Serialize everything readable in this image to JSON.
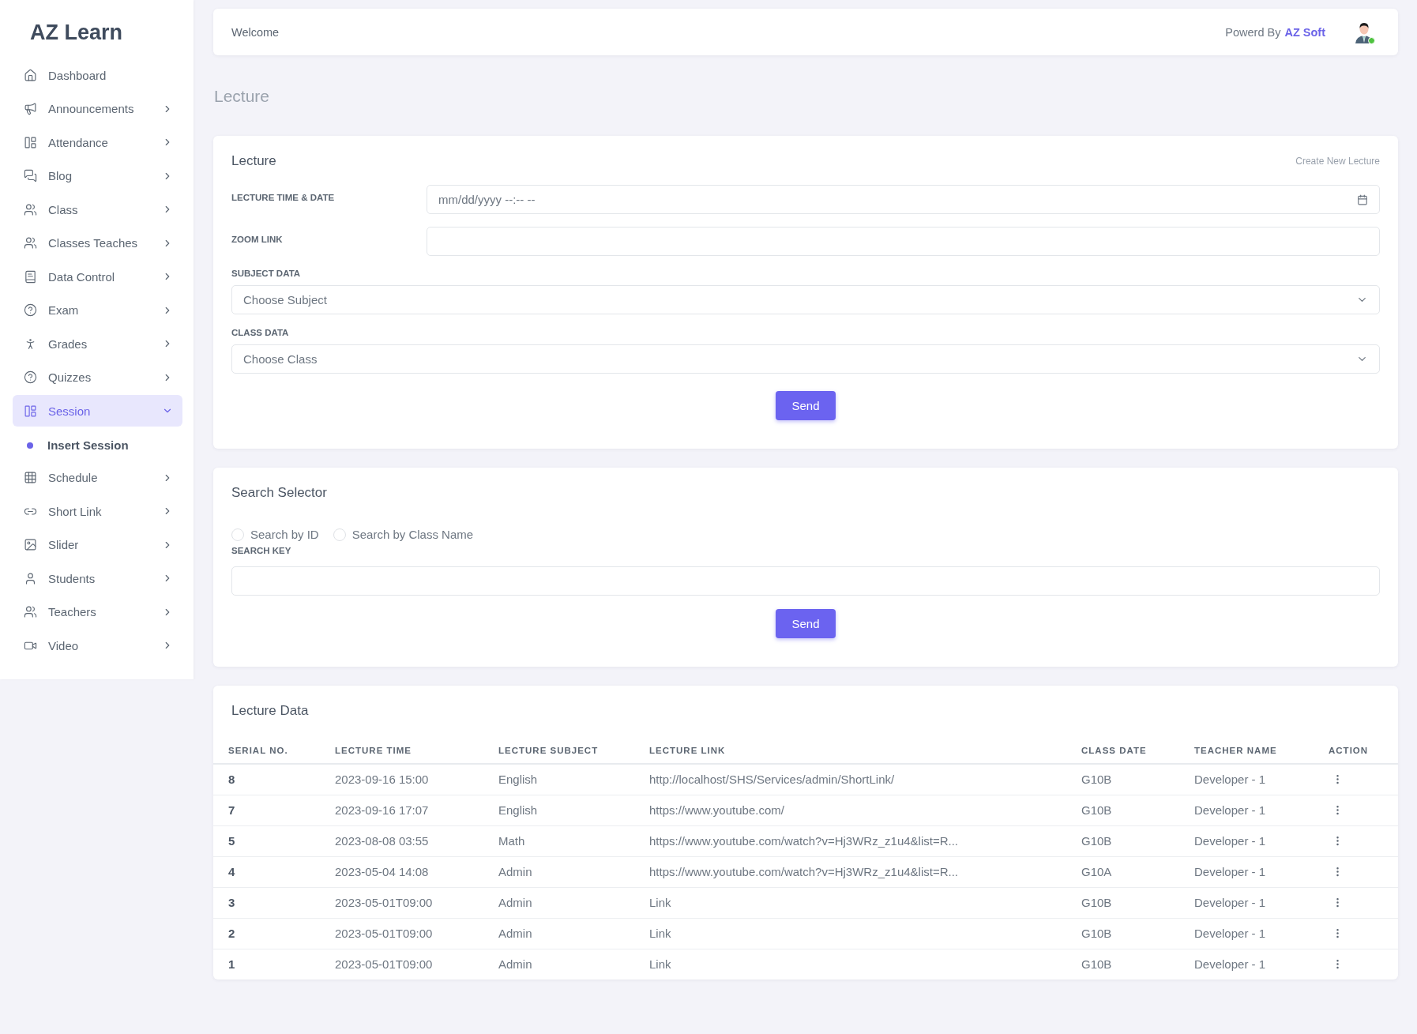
{
  "sidebar": {
    "logo": "AZ Learn",
    "items": [
      {
        "label": "Dashboard",
        "kind": "link",
        "selected": false
      },
      {
        "label": "Announcements",
        "kind": "menu",
        "selected": false,
        "expanded": false
      },
      {
        "label": "Attendance",
        "kind": "menu",
        "selected": false,
        "expanded": false
      },
      {
        "label": "Blog",
        "kind": "menu",
        "selected": false,
        "expanded": false
      },
      {
        "label": "Class",
        "kind": "menu",
        "selected": false,
        "expanded": false
      },
      {
        "label": "Classes Teaches",
        "kind": "menu",
        "selected": false,
        "expanded": false
      },
      {
        "label": "Data Control",
        "kind": "menu",
        "selected": false,
        "expanded": false
      },
      {
        "label": "Exam",
        "kind": "menu",
        "selected": false,
        "expanded": false
      },
      {
        "label": "Grades",
        "kind": "menu",
        "selected": false,
        "expanded": false
      },
      {
        "label": "Quizzes",
        "kind": "menu",
        "selected": false,
        "expanded": false
      },
      {
        "label": "Session",
        "kind": "menu",
        "selected": true,
        "expanded": true,
        "children": [
          {
            "label": "Insert Session",
            "selected": true
          }
        ]
      },
      {
        "label": "Schedule",
        "kind": "menu",
        "selected": false,
        "expanded": false
      },
      {
        "label": "Short Link",
        "kind": "menu",
        "selected": false,
        "expanded": false
      },
      {
        "label": "Slider",
        "kind": "menu",
        "selected": false,
        "expanded": false
      },
      {
        "label": "Students",
        "kind": "menu",
        "selected": false,
        "expanded": false
      },
      {
        "label": "Teachers",
        "kind": "menu",
        "selected": false,
        "expanded": false
      },
      {
        "label": "Video",
        "kind": "menu",
        "selected": false,
        "expanded": false
      }
    ]
  },
  "header": {
    "welcome": "Welcome",
    "powered_by": "Powerd By",
    "brand": "AZ Soft",
    "online": true
  },
  "page_title": "Lecture",
  "lecture_form": {
    "title": "Lecture",
    "action_link": "Create New Lecture",
    "fields": [
      {
        "label": "LECTURE TIME & DATE",
        "kind": "datetime",
        "placeholder": "mm/dd/yyyy --:-- --"
      },
      {
        "label": "ZOOM LINK",
        "kind": "text"
      },
      {
        "label": "SUBJECT DATA",
        "kind": "select",
        "value": "Choose Subject"
      },
      {
        "label": "CLASS DATA",
        "kind": "select",
        "value": "Choose Class"
      }
    ],
    "button": "Send"
  },
  "search_form": {
    "title": "Search Selector",
    "radios": [
      {
        "label": "Search by ID",
        "selected": false
      },
      {
        "label": "Search by Class Name",
        "selected": false
      }
    ],
    "key_label": "SEARCH KEY",
    "button": "Send"
  },
  "table": {
    "title": "Lecture Data",
    "columns": [
      "SERIAL NO.",
      "LECTURE TIME",
      "LECTURE SUBJECT",
      "LECTURE LINK",
      "CLASS DATE",
      "TEACHER NAME",
      "ACTION"
    ],
    "rows": [
      [
        "8",
        "2023-09-16 15:00",
        "English",
        "http://localhost/SHS/Services/admin/ShortLink/",
        "G10B",
        "Developer - 1"
      ],
      [
        "7",
        "2023-09-16 17:07",
        "English",
        "https://www.youtube.com/",
        "G10B",
        "Developer - 1"
      ],
      [
        "5",
        "2023-08-08 03:55",
        "Math",
        "https://www.youtube.com/watch?v=Hj3WRz_z1u4&list=R...",
        "G10B",
        "Developer - 1"
      ],
      [
        "4",
        "2023-05-04 14:08",
        "Admin",
        "https://www.youtube.com/watch?v=Hj3WRz_z1u4&list=R...",
        "G10A",
        "Developer - 1"
      ],
      [
        "3",
        "2023-05-01T09:00",
        "Admin",
        "Link",
        "G10B",
        "Developer - 1"
      ],
      [
        "2",
        "2023-05-01T09:00",
        "Admin",
        "Link",
        "G10B",
        "Developer - 1"
      ],
      [
        "1",
        "2023-05-01T09:00",
        "Admin",
        "Link",
        "G10B",
        "Developer - 1"
      ]
    ]
  }
}
